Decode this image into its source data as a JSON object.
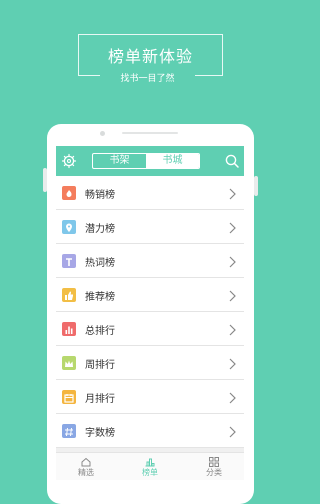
{
  "headline": {
    "title": "榜单新体验",
    "subtitle": "找书一目了然"
  },
  "header": {
    "tabs": [
      "书架",
      "书城"
    ],
    "active_tab": 1
  },
  "rankings": [
    {
      "label": "畅销榜",
      "icon": "fire-icon",
      "color": "#f47d5d"
    },
    {
      "label": "潜力榜",
      "icon": "location-pin-icon",
      "color": "#7fc7ea"
    },
    {
      "label": "热词榜",
      "icon": "text-icon",
      "color": "#a7a7e6"
    },
    {
      "label": "推荐榜",
      "icon": "thumbs-up-icon",
      "color": "#f2be45"
    },
    {
      "label": "总排行",
      "icon": "bar-chart-icon",
      "color": "#ef6b6b"
    },
    {
      "label": "周排行",
      "icon": "crown-icon",
      "color": "#b7d86e"
    },
    {
      "label": "月排行",
      "icon": "calendar-icon",
      "color": "#f4b53f"
    },
    {
      "label": "字数榜",
      "icon": "number-icon",
      "color": "#89a7e4"
    }
  ],
  "tabbar": [
    {
      "label": "精选",
      "icon": "home-icon"
    },
    {
      "label": "榜单",
      "icon": "ranking-icon"
    },
    {
      "label": "分类",
      "icon": "category-grid-icon"
    }
  ],
  "active_tab": 1,
  "colors": {
    "accent": "#5fcfb2",
    "background": "#5fcfb2"
  }
}
